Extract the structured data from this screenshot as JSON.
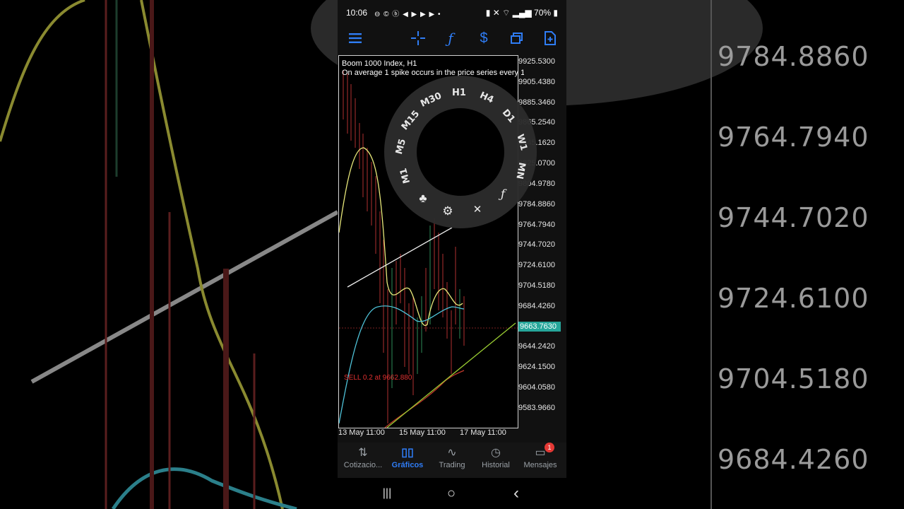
{
  "status_bar": {
    "time": "10:06",
    "icons": "⊖ © ⓑ ◀ ▶ ▶ ▶ •",
    "battery": "70%"
  },
  "toolbar": {
    "menu_icon": "menu-icon",
    "crosshair_icon": "crosshair-icon",
    "indicator_icon": "function-icon",
    "symbol_icon": "dollar-arrows-icon",
    "window_icon": "windows-icon",
    "new_order_icon": "new-order-icon",
    "accent_color": "#2f7df6"
  },
  "chart": {
    "symbol": "Boom 1000 Index, H1",
    "description": "On average 1 spike occurs in the price series every 1...",
    "y_ticks": [
      "9925.5300",
      "9905.4380",
      "9885.3460",
      "9865.2540",
      "9845.1620",
      "9825.0700",
      "9804.9780",
      "9784.8860",
      "9764.7940",
      "9744.7020",
      "9724.6100",
      "9704.5180",
      "9684.4260",
      "9663.7630",
      "9644.2420",
      "9624.1500",
      "9604.0580",
      "9583.9660"
    ],
    "current_price": "9663.7630",
    "x_ticks": [
      "13 May 11:00",
      "15 May 11:00",
      "17 May 11:00"
    ],
    "sell_label": "SELL 0.2 at 9662.880",
    "timeframes": [
      "M1",
      "M5",
      "M15",
      "M30",
      "H1",
      "H4",
      "D1",
      "W1",
      "MN"
    ],
    "ring_tools": [
      "crosshair-icon",
      "gear-icon",
      "objects-icon",
      "function-icon"
    ],
    "colors": {
      "yellow_ma": "#e8e87a",
      "cyan_ma": "#4fc3d9",
      "red_ma": "#c0392b",
      "trendline": "#9acd32",
      "current_price_bg": "#26a69a"
    }
  },
  "bottom_nav": {
    "items": [
      {
        "label": "Cotizacio...",
        "icon": "quotes-icon"
      },
      {
        "label": "Gráficos",
        "icon": "charts-icon",
        "active": true
      },
      {
        "label": "Trading",
        "icon": "trading-icon"
      },
      {
        "label": "Historial",
        "icon": "history-icon"
      },
      {
        "label": "Mensajes",
        "icon": "messages-icon",
        "badge": "1"
      }
    ]
  },
  "system_nav": {
    "recents": "|||",
    "home": "○",
    "back": "‹"
  },
  "background_zoom": {
    "prices": [
      "9784.8860",
      "9764.7940",
      "9744.7020",
      "9724.6100",
      "9704.5180",
      "9684.4260"
    ]
  }
}
